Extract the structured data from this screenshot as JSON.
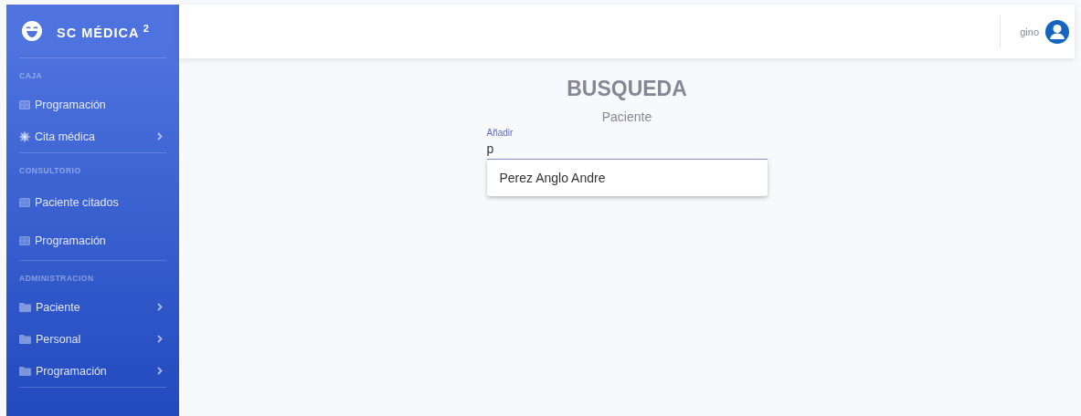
{
  "sidebar": {
    "brand": {
      "name": "SC MÉDICA",
      "superscript": "2"
    },
    "sections": [
      {
        "heading": "CAJA",
        "items": [
          {
            "label": "Programación",
            "kind": "grid",
            "has_submenu": false
          },
          {
            "label": "Cita médica",
            "kind": "gear",
            "has_submenu": true
          }
        ]
      },
      {
        "heading": "CONSULTORIO",
        "items": [
          {
            "label": "Paciente citados",
            "kind": "grid",
            "has_submenu": false
          },
          {
            "label": "Programación",
            "kind": "grid",
            "has_submenu": false
          }
        ]
      },
      {
        "heading": "ADMINISTRACION",
        "items": [
          {
            "label": "Paciente",
            "kind": "folder",
            "has_submenu": true
          },
          {
            "label": "Personal",
            "kind": "folder",
            "has_submenu": true
          },
          {
            "label": "Programación",
            "kind": "folder",
            "has_submenu": true
          }
        ]
      }
    ]
  },
  "topbar": {
    "user_name": "gino"
  },
  "main": {
    "title": "BUSQUEDA",
    "subtitle": "Paciente",
    "field": {
      "label": "Añadir",
      "value": "p"
    },
    "suggestions": [
      "Perez Anglo Andre"
    ]
  }
}
